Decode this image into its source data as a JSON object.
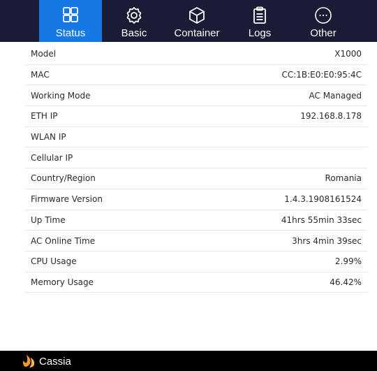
{
  "nav": {
    "tabs": [
      {
        "label": "Status",
        "icon": "grid-icon",
        "active": true
      },
      {
        "label": "Basic",
        "icon": "gear-icon",
        "active": false
      },
      {
        "label": "Container",
        "icon": "cube-icon",
        "active": false
      },
      {
        "label": "Logs",
        "icon": "clipboard-icon",
        "active": false
      },
      {
        "label": "Other",
        "icon": "more-icon",
        "active": false
      }
    ]
  },
  "status": {
    "rows": [
      {
        "label": "Model",
        "value": "X1000"
      },
      {
        "label": "MAC",
        "value": "CC:1B:E0:E0:95:4C"
      },
      {
        "label": "Working Mode",
        "value": "AC Managed"
      },
      {
        "label": "ETH IP",
        "value": "192.168.8.178"
      },
      {
        "label": "WLAN IP",
        "value": ""
      },
      {
        "label": "Cellular IP",
        "value": ""
      },
      {
        "label": "Country/Region",
        "value": "Romania"
      },
      {
        "label": "Firmware Version",
        "value": "1.4.3.1908161524"
      },
      {
        "label": "Up Time",
        "value": "41hrs 55min 33sec"
      },
      {
        "label": "AC Online Time",
        "value": "3hrs 4min 39sec"
      },
      {
        "label": "CPU Usage",
        "value": "2.99%"
      },
      {
        "label": "Memory Usage",
        "value": "46.42%"
      }
    ]
  },
  "footer": {
    "brand": "Cassia",
    "logo_icon": "cassia-flame-icon"
  },
  "colors": {
    "nav_bg": "#1a1b34",
    "active_tab": "#1479e4",
    "footer_bg": "#000000",
    "logo": "#f59a23"
  }
}
